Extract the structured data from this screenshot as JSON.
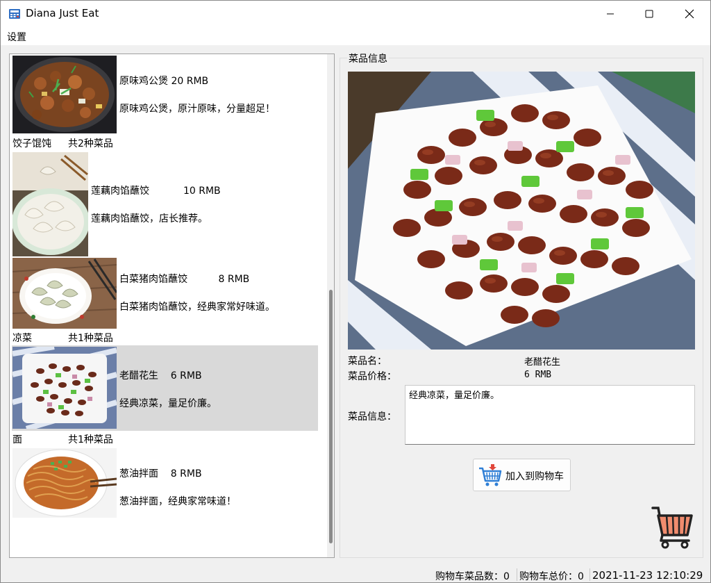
{
  "window": {
    "title": "Diana Just Eat"
  },
  "menu": {
    "items": [
      "设置"
    ]
  },
  "dish_list": [
    {
      "kind": "dish",
      "title": "原味鸡公煲 20 RMB",
      "desc": "原味鸡公煲，原汁原味，分量超足！",
      "image": "chicken-pot-photo"
    },
    {
      "kind": "category",
      "name": "饺子馄饨",
      "count": "共2种菜品"
    },
    {
      "kind": "dish",
      "title": "莲藕肉馅蘸饺           10 RMB",
      "desc": "莲藕肉馅蘸饺，店长推荐。",
      "image": "lotus-dumplings-photo"
    },
    {
      "kind": "dish",
      "title": "白菜猪肉馅蘸饺          8 RMB",
      "desc": "白菜猪肉馅蘸饺，经典家常好味道。",
      "image": "cabbage-dumplings-photo"
    },
    {
      "kind": "category",
      "name": "凉菜",
      "count": "共1种菜品"
    },
    {
      "kind": "dish",
      "title": "老醋花生    6 RMB",
      "desc": "经典凉菜，量足价廉。",
      "image": "vinegar-peanuts-photo",
      "selected": true
    },
    {
      "kind": "category",
      "name": "面",
      "count": "共1种菜品"
    },
    {
      "kind": "dish",
      "title": "葱油拌面    8 RMB",
      "desc": "葱油拌面，经典家常味道！",
      "image": "scallion-noodles-photo"
    }
  ],
  "detail": {
    "group_title": "菜品信息",
    "image": "vinegar-peanuts-photo",
    "name_label": "菜品名：",
    "name_value": "老醋花生",
    "price_label": "菜品价格：",
    "price_value": "6 RMB",
    "info_label": "菜品信息：",
    "info_value": "经典凉菜，量足价廉。",
    "add_button_label": "加入到购物车",
    "add_button_icon": "cart-add-icon",
    "cart_icon": "shopping-cart-icon"
  },
  "status": {
    "cart_count": "购物车菜品数：0",
    "cart_total": "购物车总价：0",
    "datetime": "2021-11-23 12:10:29"
  },
  "colors": {
    "selected_row": "#d9d9d9",
    "cart_basket": "#f08c6e",
    "cart_frame": "#222222",
    "add_icon_blue": "#2f7fd6",
    "add_icon_red": "#e0463a"
  }
}
